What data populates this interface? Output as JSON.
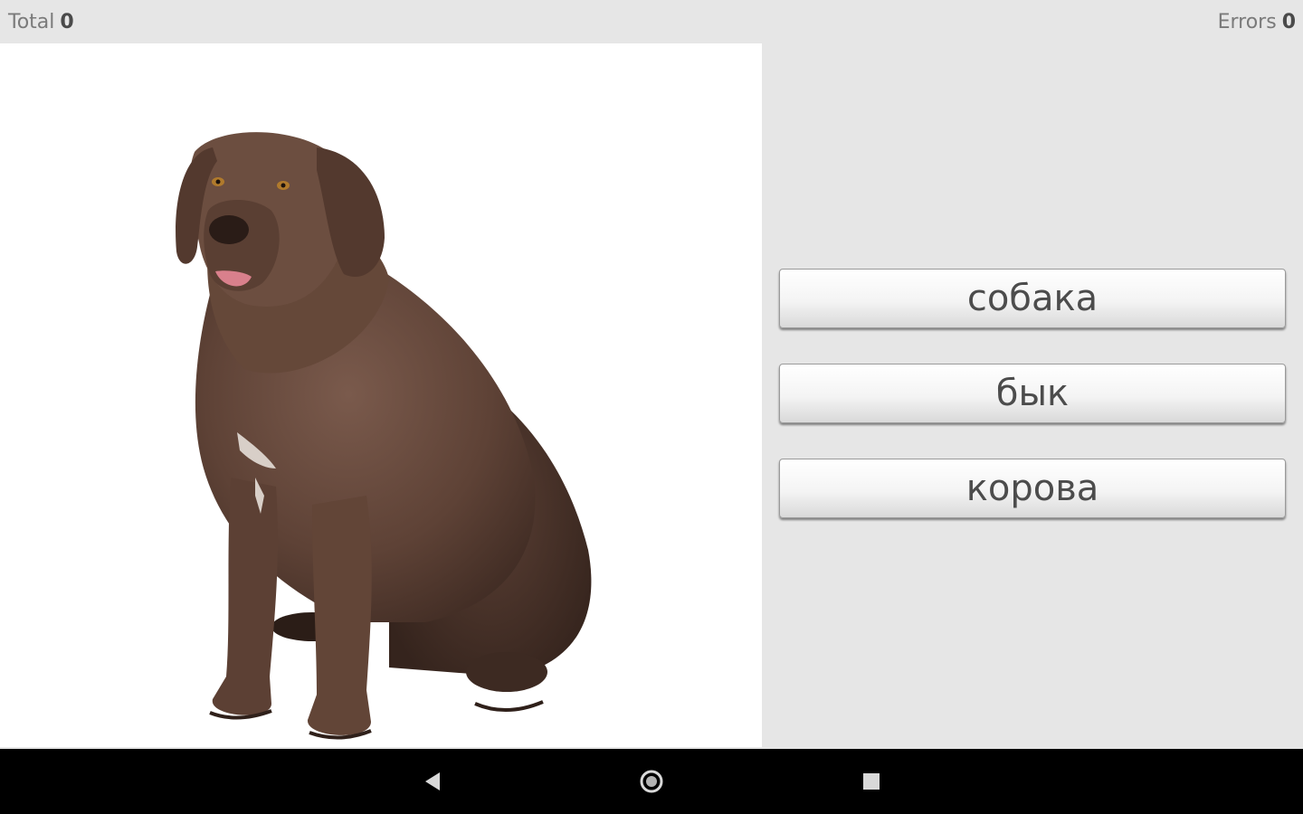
{
  "status": {
    "total_label": "Total",
    "total_value": "0",
    "errors_label": "Errors",
    "errors_value": "0"
  },
  "quiz": {
    "picture_icon": "dog-picture",
    "answers": [
      "собака",
      "бык",
      "корова"
    ]
  },
  "navbar": {
    "back_icon": "back-triangle-icon",
    "home_icon": "home-circle-icon",
    "recent_icon": "recent-apps-square-icon"
  },
  "colors": {
    "background": "#e6e6e6",
    "image_bg": "#ffffff",
    "button_text": "#4c4c4c",
    "navbar": "#000000"
  }
}
